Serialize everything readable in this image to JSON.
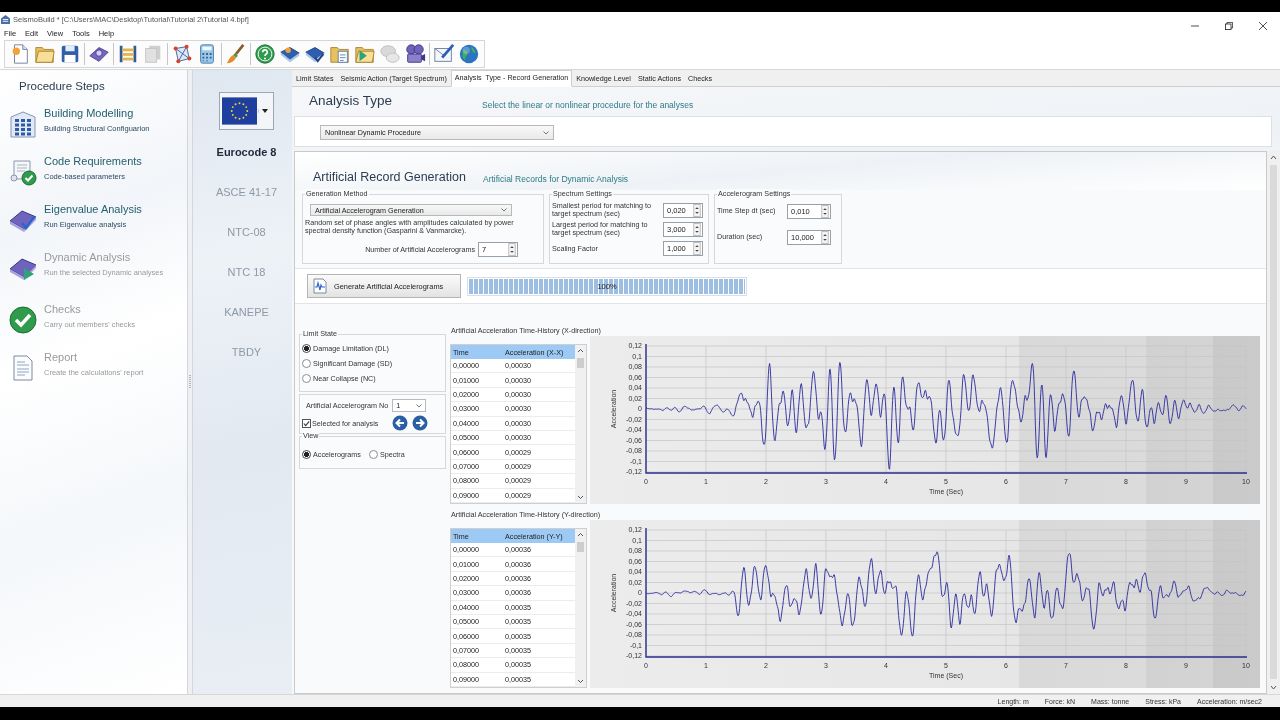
{
  "window": {
    "title": "SeismoBuild * [C:\\Users\\MAC\\Desktop\\Tutorial\\Tutorial 2\\Tutorial 4.bpf]"
  },
  "menu": [
    "File",
    "Edit",
    "View",
    "Tools",
    "Help"
  ],
  "toolbar": [
    [
      {
        "kind": "new",
        "disabled": false
      },
      {
        "kind": "open",
        "disabled": false
      },
      {
        "kind": "save",
        "disabled": false
      }
    ],
    [
      {
        "kind": "machine",
        "disabled": false
      }
    ],
    [
      {
        "kind": "frame",
        "disabled": false
      },
      {
        "kind": "pages",
        "disabled": true
      }
    ],
    [
      {
        "kind": "network",
        "disabled": false
      },
      {
        "kind": "calculator",
        "disabled": false
      }
    ],
    [
      {
        "kind": "brush",
        "disabled": false
      }
    ],
    [
      {
        "kind": "help",
        "disabled": false
      },
      {
        "kind": "book",
        "disabled": false
      },
      {
        "kind": "bookcheck",
        "disabled": false
      },
      {
        "kind": "folderdoc",
        "disabled": false
      },
      {
        "kind": "folderplay",
        "disabled": false
      },
      {
        "kind": "chat",
        "disabled": true
      },
      {
        "kind": "reel",
        "disabled": false
      }
    ],
    [
      {
        "kind": "penletter",
        "disabled": false
      },
      {
        "kind": "globe",
        "disabled": false
      }
    ]
  ],
  "procedure_steps": {
    "title": "Procedure Steps",
    "items": [
      {
        "kind": "building",
        "title": "Building Modelling",
        "subtitle": "Building Structural Configuarion",
        "disabled": false
      },
      {
        "kind": "code",
        "title": "Code Requirements",
        "subtitle": "Code-based parameters",
        "disabled": false
      },
      {
        "kind": "eigen",
        "title": "Eigenvalue Analysis",
        "subtitle": "Run Eigenvalue analysis",
        "disabled": false
      },
      {
        "kind": "dynamic",
        "title": "Dynamic Analysis",
        "subtitle": "Run the selected Dynamic analyses",
        "disabled": true
      },
      {
        "kind": "checks",
        "title": "Checks",
        "subtitle": "Carry out members' checks",
        "disabled": true
      },
      {
        "kind": "report",
        "title": "Report",
        "subtitle": "Create the calculations' report",
        "disabled": true
      }
    ]
  },
  "codes": [
    {
      "label": "Eurocode 8",
      "selected": true
    },
    {
      "label": "ASCE 41-17",
      "selected": false
    },
    {
      "label": "NTC-08",
      "selected": false
    },
    {
      "label": "NTC 18",
      "selected": false
    },
    {
      "label": "KANEPE",
      "selected": false
    },
    {
      "label": "TBDY",
      "selected": false
    }
  ],
  "tabs": [
    {
      "label": "Limit States",
      "selected": false
    },
    {
      "label": "Seismic Action (Target Spectrum)",
      "selected": false
    },
    {
      "label": "Analysis  Type - Record Generation",
      "selected": true
    },
    {
      "label": "Knowledge Level",
      "selected": false
    },
    {
      "label": "Static Actions",
      "selected": false
    },
    {
      "label": "Checks",
      "selected": false
    }
  ],
  "analysis_type": {
    "title": "Analysis Type",
    "hint": "Select the linear or nonlinear procedure for the analyses",
    "procedure": "Nonlinear Dynamic Procedure"
  },
  "record_generation": {
    "title": "Artificial Record Generation",
    "subtitle": "Artificial Records for Dynamic Analysis",
    "generation_method": {
      "legend": "Generation Method",
      "method": "Artificial Accelerogram Generation",
      "description": "Random set of phase angles with amplitudes calculated by power spectral density function (Gasparini & Vanmarcke).",
      "count_label": "Number of Artificial Accelerograms",
      "count": "7"
    },
    "spectrum_settings": {
      "legend": "Spectrum Settings",
      "fields": [
        {
          "label": "Smallest period for matching to target spectrum (sec)",
          "value": "0,020"
        },
        {
          "label": "Largest period for matching to target spectrum (sec)",
          "value": "3,000"
        },
        {
          "label": "Scaling Factor",
          "value": "1,000"
        }
      ]
    },
    "accelerogram_settings": {
      "legend": "Accelerogram Settings",
      "fields": [
        {
          "label": "Time Step dt (sec)",
          "value": "0,010"
        },
        {
          "label": "Duration (sec)",
          "value": "10,000"
        }
      ]
    },
    "generate_button": "Generate Artificial Accelerograms",
    "progress": {
      "level": 1,
      "reading": "100%"
    }
  },
  "limit_state": {
    "legend": "Limit State",
    "options": [
      {
        "label": "Damage Limitation (DL)",
        "selected": true
      },
      {
        "label": "Significant Damage (SD)",
        "selected": false
      },
      {
        "label": "Near Collapse (NC)",
        "selected": false
      }
    ]
  },
  "accelerogram_no": {
    "label": "Artificial Accelerogram No",
    "value": "1"
  },
  "selected_for_analysis": {
    "label": "Selected for analysis",
    "checked": true
  },
  "view": {
    "legend": "View",
    "options": [
      {
        "label": "Accelerograms",
        "selected": true
      },
      {
        "label": "Spectra",
        "selected": false
      }
    ]
  },
  "time_histories": [
    {
      "title": "Artificial Acceleration Time-History (X-direction)",
      "columns": [
        "Time",
        "Acceleration (X-X)"
      ],
      "rows": [
        [
          "0,00000",
          "0,00030"
        ],
        [
          "0,01000",
          "0,00030"
        ],
        [
          "0,02000",
          "0,00030"
        ],
        [
          "0,03000",
          "0,00030"
        ],
        [
          "0,04000",
          "0,00030"
        ],
        [
          "0,05000",
          "0,00030"
        ],
        [
          "0,06000",
          "0,00029"
        ],
        [
          "0,07000",
          "0,00029"
        ],
        [
          "0,08000",
          "0,00029"
        ],
        [
          "0,09000",
          "0,00029"
        ]
      ],
      "plot": {
        "ylabel": "Acceleration",
        "xlabel": "Time (Sec)",
        "y_tick_labels": [
          "0,12",
          "0,1",
          "0,08",
          "0,06",
          "0,04",
          "0,02",
          "0",
          "-0,02",
          "-0,04",
          "-0,06",
          "-0,08",
          "-0,1",
          "-0,12"
        ],
        "x_tick_labels": [
          "0",
          "1",
          "2",
          "3",
          "4",
          "5",
          "6",
          "7",
          "8",
          "9",
          "10"
        ]
      }
    },
    {
      "title": "Artificial Acceleration Time-History (Y-direction)",
      "columns": [
        "Time",
        "Acceleration (Y-Y)"
      ],
      "rows": [
        [
          "0,00000",
          "0,00036"
        ],
        [
          "0,01000",
          "0,00036"
        ],
        [
          "0,02000",
          "0,00036"
        ],
        [
          "0,03000",
          "0,00036"
        ],
        [
          "0,04000",
          "0,00035"
        ],
        [
          "0,05000",
          "0,00035"
        ],
        [
          "0,06000",
          "0,00035"
        ],
        [
          "0,07000",
          "0,00035"
        ],
        [
          "0,08000",
          "0,00035"
        ],
        [
          "0,09000",
          "0,00035"
        ]
      ],
      "plot": {
        "ylabel": "Acceleration",
        "xlabel": "Time (Sec)",
        "y_tick_labels": [
          "0,12",
          "0,1",
          "0,08",
          "0,06",
          "0,04",
          "0,02",
          "0",
          "-0,02",
          "-0,04",
          "-0,06",
          "-0,08",
          "-0,1",
          "-0,12"
        ],
        "x_tick_labels": [
          "0",
          "1",
          "2",
          "3",
          "4",
          "5",
          "6",
          "7",
          "8",
          "9",
          "10"
        ]
      }
    }
  ],
  "status_bar": [
    "Length: m",
    "Force: kN",
    "Mass: tonne",
    "Stress: kPa",
    "Acceleration: m/sec2"
  ]
}
